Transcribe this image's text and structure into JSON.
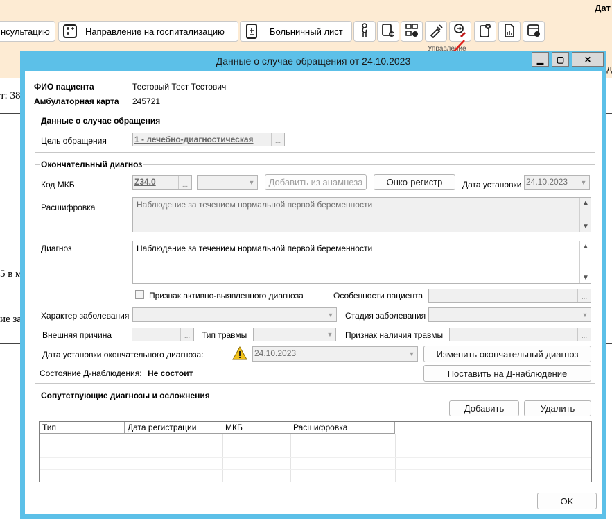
{
  "app": {
    "top_right_text": "Дат",
    "toolbar": {
      "consult_label": "нсультацию",
      "hospitalization_label": "Направление на госпитализацию",
      "sick_leave_label": "Больничный лист",
      "group_label": "Управление"
    },
    "bg_left_1": "т: 38",
    "bg_left_2": "5 в м",
    "bg_left_3": "ие за",
    "bg_right_char": "д"
  },
  "dialog": {
    "title": "Данные о случае обращения от 24.10.2023",
    "minimize": "▁",
    "maximize": "▢",
    "close": "✕",
    "patient": {
      "fio_label": "ФИО пациента",
      "fio_value": "Тестовый Тест Тестович",
      "card_label": "Амбулаторная карта",
      "card_value": "245721"
    },
    "case_section": {
      "legend": "Данные о случае обращения",
      "purpose_label": "Цель обращения",
      "purpose_value": "1 - лечебно-диагностическая"
    },
    "final_diag": {
      "legend": "Окончательный диагноз",
      "mkb_label": "Код МКБ",
      "mkb_value": "Z34.0",
      "add_from_anamnesis": "Добавить из анамнеза",
      "onko_register": "Онко-регистр",
      "install_date_label": "Дата установки",
      "install_date_value": "24.10.2023",
      "decode_label": "Расшифровка",
      "decode_value": "Наблюдение за течением нормальной первой беременности",
      "diagnosis_label": "Диагноз",
      "diagnosis_value": "Наблюдение за течением нормальной первой беременности",
      "active_sign_label": "Признак активно-выявленного диагноза",
      "patient_features_label": "Особенности пациента",
      "disease_character_label": "Характер заболевания",
      "disease_stage_label": "Стадия заболевания",
      "external_cause_label": "Внешняя причина",
      "injury_type_label": "Тип травмы",
      "injury_sign_label": "Признак наличия травмы",
      "final_date_label": "Дата установки окончательного диагноза:",
      "final_date_value": "24.10.2023",
      "change_final_btn": "Изменить окончательный диагноз",
      "d_state_label": "Состояние Д-наблюдения:",
      "d_state_value": "Не состоит",
      "put_d_btn": "Поставить на Д-наблюдение"
    },
    "concomitant": {
      "legend": "Сопутствующие диагнозы и осложнения",
      "add_btn": "Добавить",
      "delete_btn": "Удалить",
      "columns": [
        "Тип",
        "Дата регистрации",
        "МКБ",
        "Расшифровка"
      ]
    },
    "ok_btn": "OK"
  },
  "colors": {
    "title_bar": "#5cc0e8",
    "app_bg": "#fdebd3",
    "annotation_arrow": "#e0201a"
  }
}
